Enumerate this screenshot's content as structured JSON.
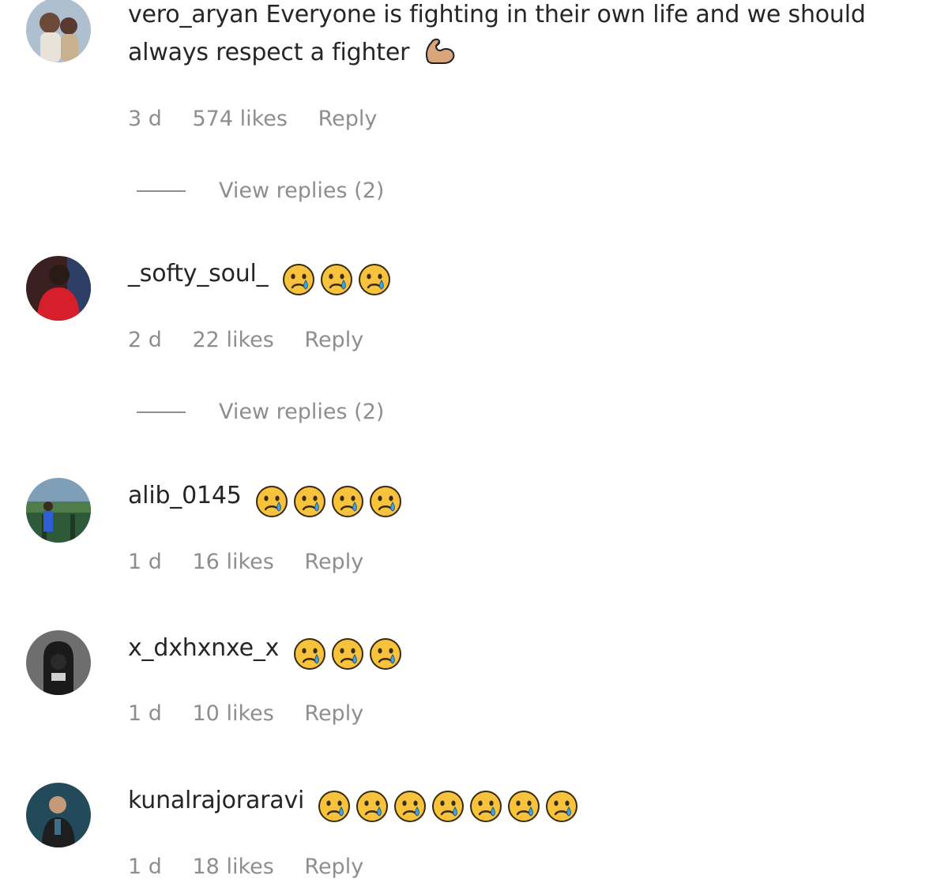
{
  "comments": [
    {
      "username": "vero_aryan",
      "text": "Everyone is fighting in their own life and we should always respect a fighter",
      "emoji": "flexed-biceps",
      "time": "3 d",
      "likes": "574 likes",
      "reply_label": "Reply",
      "view_replies": "View replies (2)",
      "avatar_colors": [
        "#9fb3c8",
        "#d9c2a7"
      ]
    },
    {
      "username": "_softy_soul_",
      "emoji": "crying-face",
      "emoji_count": 3,
      "time": "2 d",
      "likes": "22 likes",
      "reply_label": "Reply",
      "view_replies": "View replies (2)",
      "avatar_colors": [
        "#d4202a",
        "#2a1a1a"
      ]
    },
    {
      "username": "alib_0145",
      "emoji": "crying-face",
      "emoji_count": 4,
      "time": "1 d",
      "likes": "16 likes",
      "reply_label": "Reply",
      "avatar_colors": [
        "#3e6b3a",
        "#2e5fd0"
      ]
    },
    {
      "username": "x_dxhxnxe_x",
      "emoji": "crying-face",
      "emoji_count": 3,
      "time": "1 d",
      "likes": "10 likes",
      "reply_label": "Reply",
      "avatar_colors": [
        "#5a5a5a",
        "#1c1c1c"
      ]
    },
    {
      "username": "kunalrajoraravi",
      "emoji": "crying-face",
      "emoji_count": 7,
      "time": "1 d",
      "likes": "18 likes",
      "reply_label": "Reply",
      "avatar_colors": [
        "#1f3d4d",
        "#2a2a2a"
      ]
    }
  ],
  "colors": {
    "text": "#262626",
    "meta": "#8e8e8e",
    "emoji_face": "#f7c33c",
    "tear": "#4aa3df"
  }
}
